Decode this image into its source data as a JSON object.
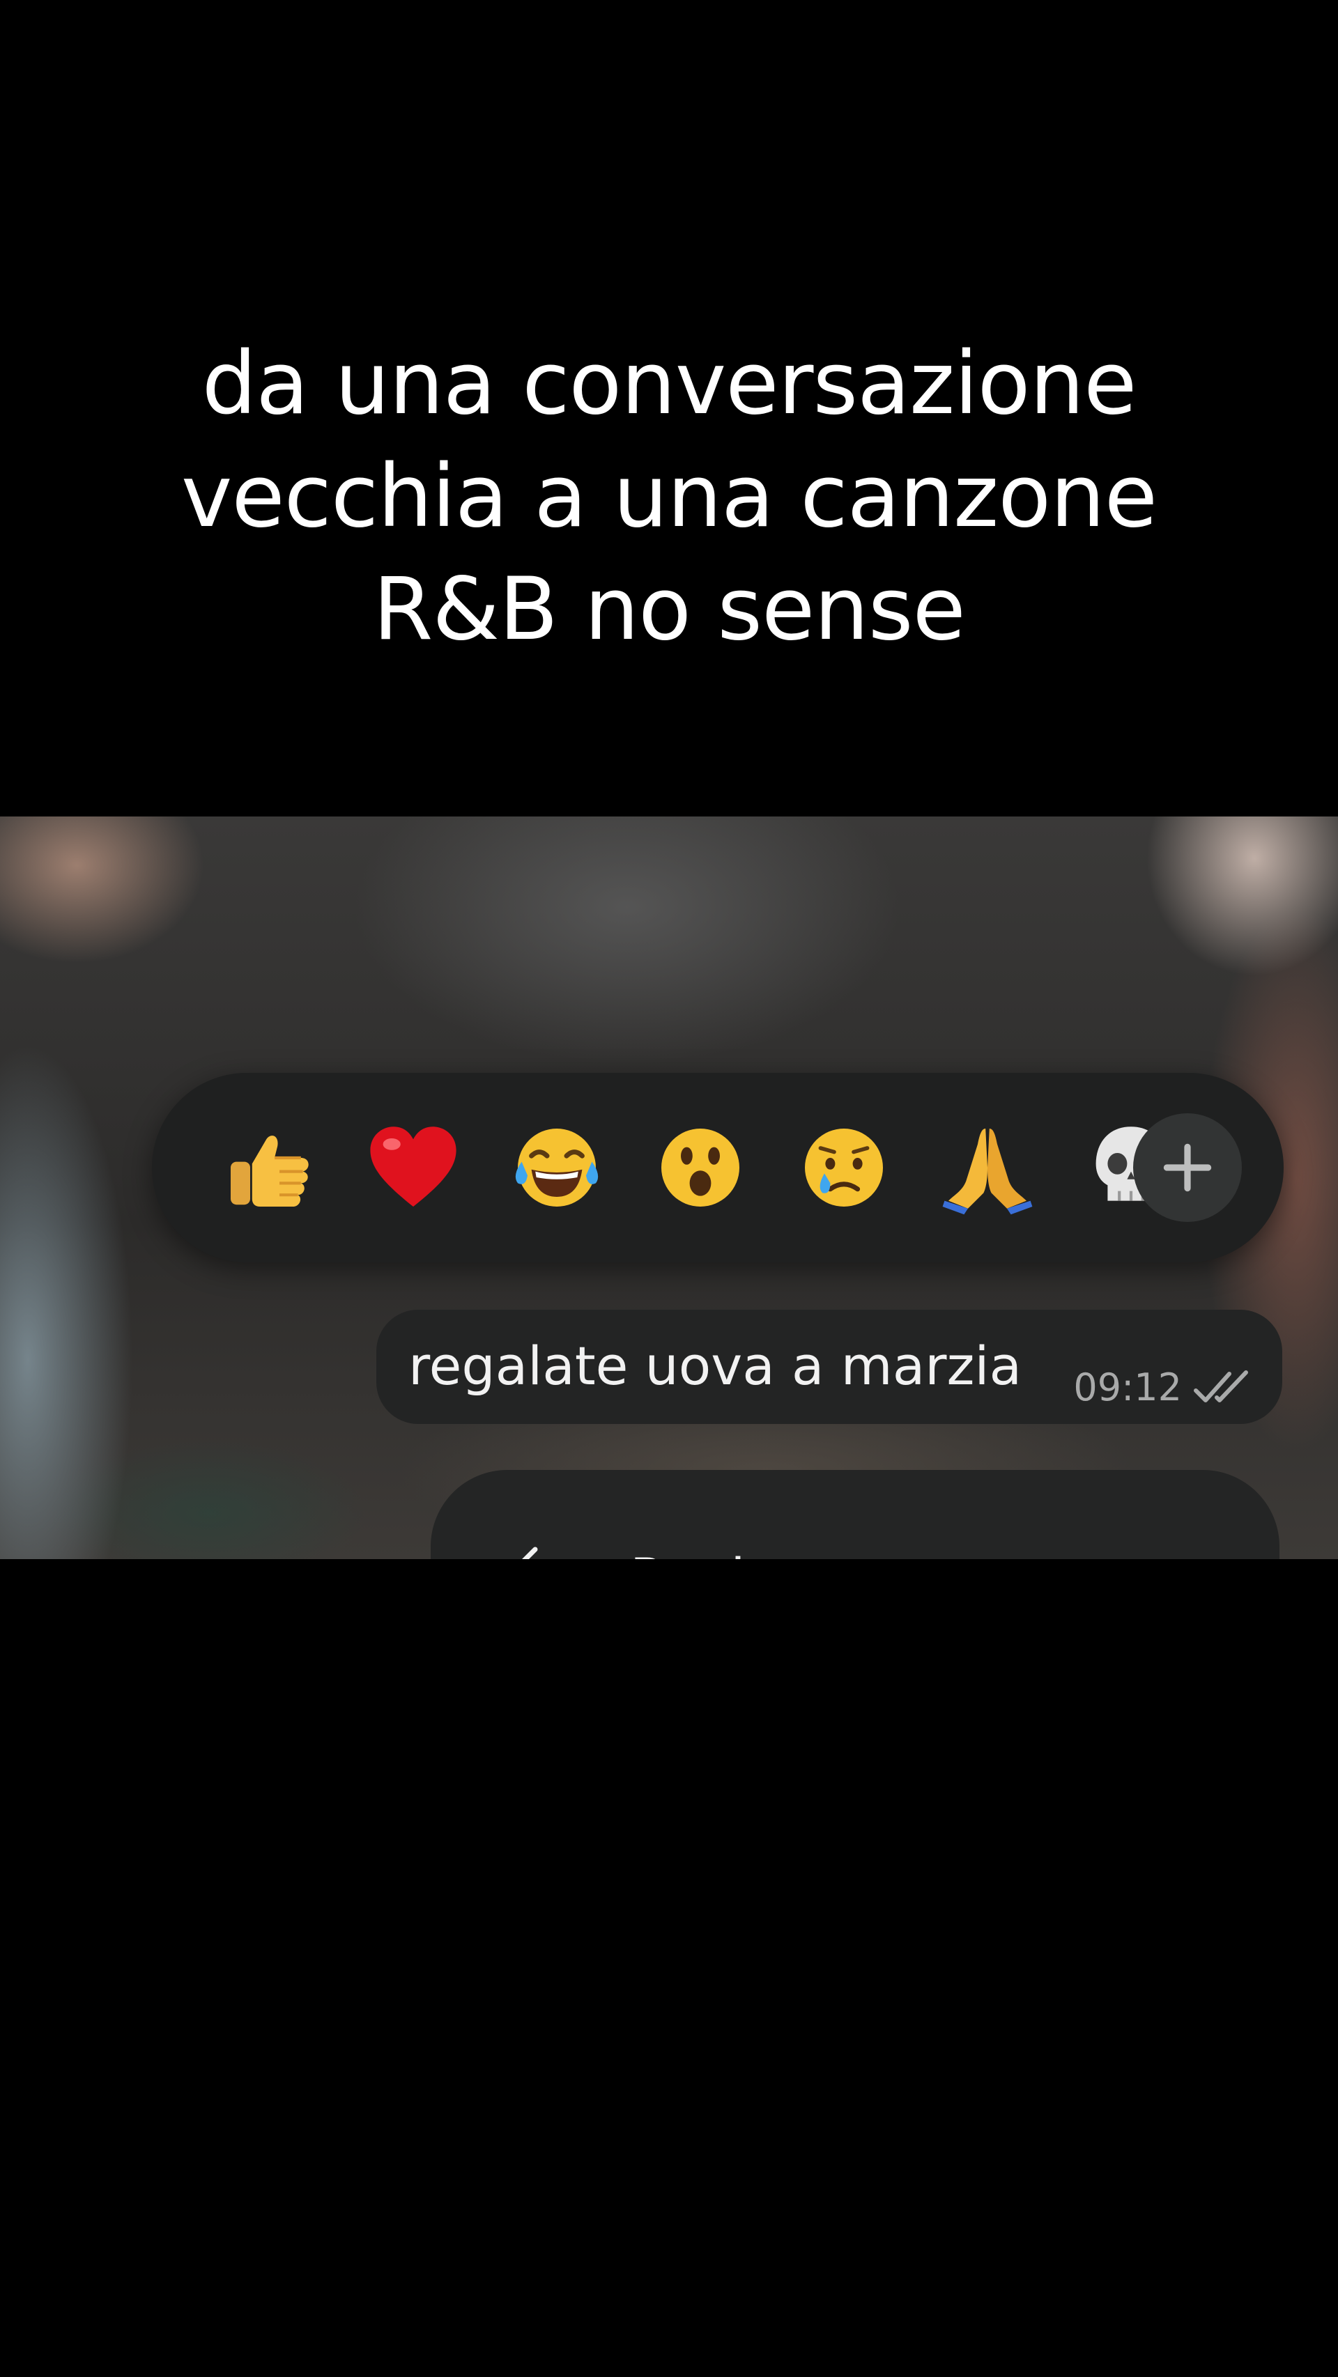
{
  "caption": {
    "lines": [
      "da una conversazione",
      "vecchia a una canzone",
      "R&B no sense"
    ]
  },
  "reaction_bar": {
    "emojis": [
      {
        "name": "thumbs-up",
        "char": "👍"
      },
      {
        "name": "red-heart",
        "char": "❤️"
      },
      {
        "name": "tears-of-joy",
        "char": "😂"
      },
      {
        "name": "surprised-face",
        "char": "😮"
      },
      {
        "name": "crying-face",
        "char": "😢"
      },
      {
        "name": "folded-hands",
        "char": "🙏"
      },
      {
        "name": "skull",
        "char": "💀"
      }
    ],
    "more_button_icon": "plus-icon"
  },
  "message": {
    "text": "regalate uova a marzia",
    "time": "09:12",
    "status_icon": "double-check-icon"
  },
  "context_menu": {
    "reply_label": "Reply",
    "reply_icon": "reply-arrow-icon"
  },
  "colors": {
    "page_background": "#000000",
    "caption_text": "#ffffff",
    "reaction_bar": "#1f2020",
    "bubble": "#232424",
    "timestamp": "#a9aaaa"
  }
}
